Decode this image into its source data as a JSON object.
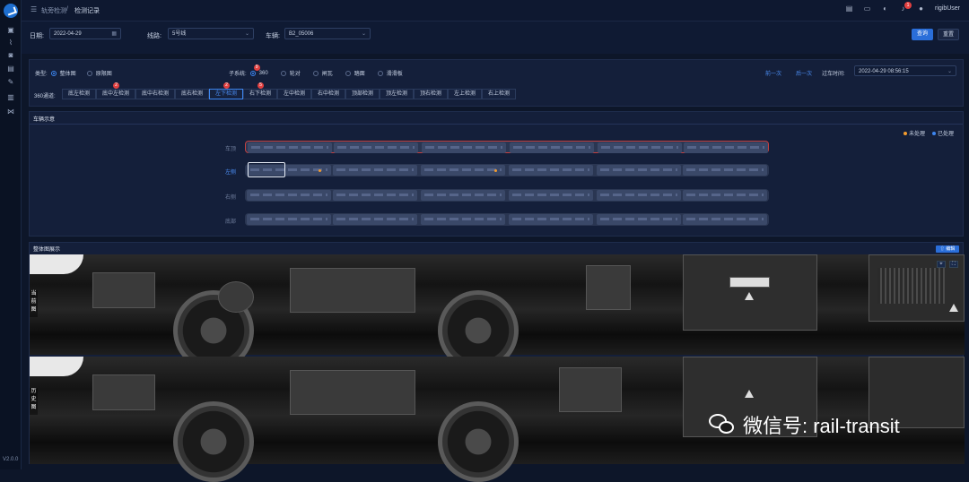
{
  "sidebar": {
    "version": "V2.0.0",
    "icons": [
      "monitor-icon",
      "chart-icon",
      "camera-icon",
      "document-icon",
      "wrench-icon",
      "bar-chart-icon",
      "flow-icon"
    ]
  },
  "header": {
    "breadcrumb_root": "轨旁检测",
    "breadcrumb_sep": "/",
    "breadcrumb_current": "检测记录",
    "notification_count": "1",
    "username": "rigibUser"
  },
  "filters": {
    "date_label": "日期:",
    "date_value": "2022-04-29",
    "line_label": "线路:",
    "line_value": "5号线",
    "vehicle_label": "车辆:",
    "vehicle_value": "B2_05006",
    "query_button": "查询",
    "reset_button": "重置"
  },
  "options": {
    "type_label": "类型:",
    "type_opt1": "整体图",
    "type_opt2": "原限图",
    "subsystem_label": "子系统:",
    "sub_360": "360",
    "sub_360_badge": "9",
    "sub_wheel": "轮对",
    "sub_brake": "闸瓦",
    "sub_pantograph": "踏面",
    "sub_slide": "滑滑板",
    "prev_label": "前一次",
    "next_label": "后一次",
    "pass_time_label": "过车时间:",
    "pass_time_value": "2022-04-29 08:56:15"
  },
  "channels": {
    "label": "360通道:",
    "items": [
      {
        "label": "底左检测",
        "badge": ""
      },
      {
        "label": "底中左检测",
        "badge": "2"
      },
      {
        "label": "底中右检测",
        "badge": ""
      },
      {
        "label": "底右检测",
        "badge": ""
      },
      {
        "label": "左下检测",
        "badge": "2"
      },
      {
        "label": "右下检测",
        "badge": "5"
      },
      {
        "label": "左中检测",
        "badge": ""
      },
      {
        "label": "右中检测",
        "badge": ""
      },
      {
        "label": "顶部检测",
        "badge": ""
      },
      {
        "label": "顶左检测",
        "badge": ""
      },
      {
        "label": "顶右检测",
        "badge": ""
      },
      {
        "label": "左上检测",
        "badge": ""
      },
      {
        "label": "右上检测",
        "badge": ""
      }
    ],
    "active_index": 4
  },
  "vehicle_diagram": {
    "title": "车辆示意",
    "legend_unprocessed": "未处理",
    "legend_processed": "已处理",
    "rows": [
      "车顶",
      "左侧",
      "右侧",
      "底部"
    ],
    "colors": {
      "unprocessed": "#f39b2e",
      "processed": "#3d86f0",
      "alert_outline": "#c44040"
    }
  },
  "image_panel": {
    "title": "整体图展示",
    "edit_button": "编辑",
    "current_label": "当前图",
    "history_label": "历史图"
  },
  "watermark": {
    "text": "微信号: rail-transit"
  }
}
